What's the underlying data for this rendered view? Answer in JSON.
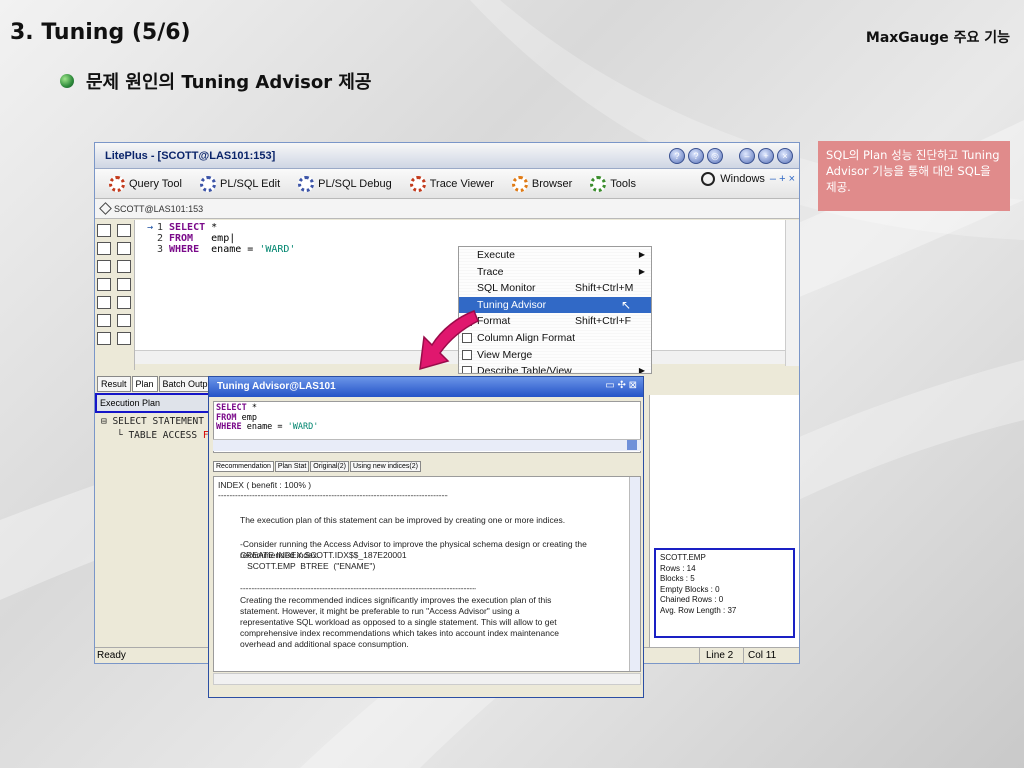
{
  "slide": {
    "title": "3. Tuning  (5/6)",
    "brand": "MaxGauge  주요 기능",
    "bullet": "문제 원인의 Tuning Advisor 제공"
  },
  "callout": {
    "text": "SQL의 Plan 성능 진단하고 Tuning Advisor 기능을 통해 대안 SQL을 제공.",
    "color": "#e08b8b"
  },
  "app": {
    "title": "LitePlus - [SCOTT@LAS101:153]",
    "menu": [
      {
        "label": "Query Tool",
        "icon": "query-tool-gear-icon"
      },
      {
        "label": "PL/SQL Edit",
        "icon": "plsql-edit-gear-icon"
      },
      {
        "label": "PL/SQL Debug",
        "icon": "plsql-debug-gear-icon"
      },
      {
        "label": "Trace Viewer",
        "icon": "trace-viewer-gear-icon"
      },
      {
        "label": "Browser",
        "icon": "browser-gear-icon"
      },
      {
        "label": "Tools",
        "icon": "tools-gear-icon"
      }
    ],
    "windows_label": "Windows",
    "windows_ctrls": "– + ×",
    "connection": "SCOTT@LAS101:153",
    "editor_lines": [
      {
        "num": "1",
        "kw": "SELECT",
        "rest": " *"
      },
      {
        "num": "2",
        "kw": "FROM",
        "rest": "   emp|"
      },
      {
        "num": "3",
        "kw": "WHERE",
        "rest": "  ename = ",
        "str": "'WARD'"
      }
    ],
    "bottom_tabs": [
      "Result",
      "Plan",
      "Batch Output"
    ],
    "exec_plan_label": "Execution Plan",
    "plan_row1": "SELECT STATEMENT A",
    "plan_row2_pre": "TABLE ACCESS ",
    "plan_row2_red": "FULL",
    "status_ready": "Ready",
    "status_line": "Line 2",
    "status_col": "Col 11"
  },
  "context_menu": {
    "items": [
      {
        "label": "Execute",
        "shortcut": "",
        "submenu": "▶",
        "selected": false
      },
      {
        "label": "Trace",
        "shortcut": "",
        "submenu": "▶",
        "selected": false
      },
      {
        "label": "SQL Monitor",
        "shortcut": "Shift+Ctrl+M",
        "submenu": "",
        "selected": false
      },
      {
        "label": "Tuning Advisor",
        "shortcut": "",
        "submenu": "",
        "selected": true
      },
      {
        "label": "Format",
        "shortcut": "Shift+Ctrl+F",
        "submenu": "",
        "selected": false
      },
      {
        "label": "Column Align Format",
        "shortcut": "",
        "submenu": "",
        "selected": false
      },
      {
        "label": "View Merge",
        "shortcut": "",
        "submenu": "",
        "selected": false
      },
      {
        "label": "Describe Table/View",
        "shortcut": "",
        "submenu": "▶",
        "selected": false
      }
    ]
  },
  "advisor": {
    "title": "Tuning Advisor@LAS101",
    "title_ctrls": "▭ ✣ ⊠",
    "sql_lines": [
      {
        "kw": "SELECT",
        "rest": " *"
      },
      {
        "kw": "FROM",
        "rest": "   emp"
      },
      {
        "kw": "WHERE",
        "rest": "  ename = ",
        "str": "'WARD'"
      }
    ],
    "tabs": [
      "Recommendation",
      "Plan Stat",
      "Original(2)",
      "Using new indices(2)"
    ],
    "body_head": "INDEX ( benefit : 100% )",
    "divider": "--------------------------------------------------------------------------------------------",
    "para1": "The execution plan of this statement can be improved by creating one or more indices.",
    "para2a": "-Consider running the Access Advisor to improve the physical schema design or creating the recommended index.",
    "para2b": "CREATE INDEX  SCOTT.IDX$$_187E20001",
    "para2c": "   SCOTT.EMP  BTREE  (\"ENAME\")",
    "divider2": "--------------------------------------------------------------------------------------------",
    "para3": "Creating the recommended indices significantly improves the execution plan of this statement. However, it might be preferable to run \"Access Advisor\" using a representative SQL workload as opposed to a single statement. This will allow to get comprehensive index recommendations which takes into account index maintenance overhead and additional space consumption."
  },
  "infobox": {
    "lines": [
      "SCOTT.EMP",
      "Rows : 14",
      "Blocks : 5",
      "Empty Blocks : 0",
      "Chained Rows : 0",
      "Avg. Row Length : 37"
    ]
  }
}
